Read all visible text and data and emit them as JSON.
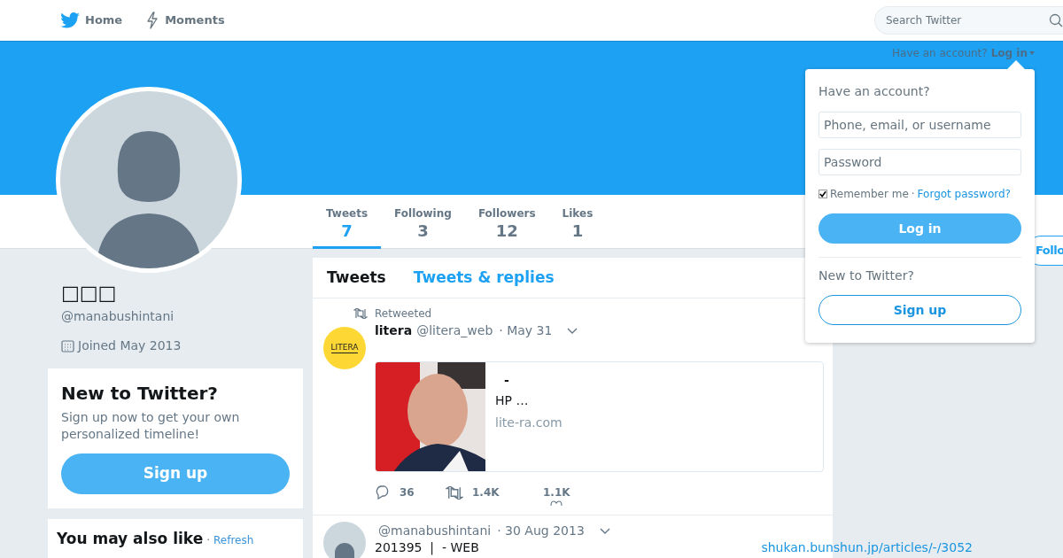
{
  "nav": {
    "items": [
      {
        "label": "Home",
        "kind": "bird"
      },
      {
        "label": "Moments",
        "kind": "bolt"
      }
    ],
    "search": {
      "placeholder": "Search Twitter"
    }
  },
  "banner": {
    "login_prompt": "Have an account?",
    "login_link": "Log in"
  },
  "profile": {
    "name": "□□□",
    "handle": "@manabushintani",
    "joined": "Joined May 2013"
  },
  "stats": [
    {
      "label": "Tweets",
      "value": "7",
      "selected": true
    },
    {
      "label": "Following",
      "value": "3",
      "selected": false
    },
    {
      "label": "Followers",
      "value": "12",
      "selected": false
    },
    {
      "label": "Likes",
      "value": "1",
      "selected": false
    }
  ],
  "follow_button": "Follo",
  "signup_card": {
    "title": "New to Twitter?",
    "text": "Sign up now to get your own personalized timeline!",
    "button": "Sign up"
  },
  "suggestions": {
    "title": "You may also like",
    "separator": "·",
    "refresh": "Refresh"
  },
  "timeline_tabs": [
    {
      "label": "Tweets",
      "selected": true
    },
    {
      "label": "Tweets & replies",
      "selected": false
    }
  ],
  "tweets": [
    {
      "kind": "retweet",
      "retweet_label": "Retweeted",
      "avatar_logo": "LITERA",
      "name": "litera",
      "handle": "@litera_web",
      "date": "· May 31",
      "card": {
        "title": "-",
        "description": "HP …",
        "domain": "lite-ra.com"
      },
      "replies": "36",
      "retweets": "1.4K",
      "likes": "1.1K"
    },
    {
      "kind": "tweet",
      "handle": "@manabushintani",
      "date": "· 30 Aug 2013",
      "text": "201395  |  - WEB",
      "link": "shukan.bunshun.jp/articles/-/3052"
    }
  ],
  "login_dropdown": {
    "title": "Have an account?",
    "username_placeholder": "Phone, email, or username",
    "password_placeholder": "Password",
    "remember": {
      "label": "Remember me",
      "checked": true
    },
    "separator": "·",
    "forgot": "Forgot password?",
    "login_button": "Log in",
    "signup_prompt": "New to Twitter?",
    "signup_button": "Sign up"
  }
}
